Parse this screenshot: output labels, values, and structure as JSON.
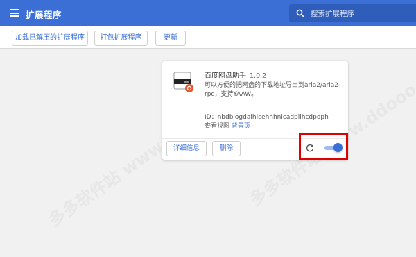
{
  "header": {
    "title": "扩展程序",
    "search_placeholder": "搜索扩展程序",
    "icons": [
      "menu-icon",
      "search-icon"
    ]
  },
  "toolbar": {
    "load_unpacked": "加载已解压的扩展程序",
    "pack": "打包扩展程序",
    "update": "更新"
  },
  "extension": {
    "name": "百度网盘助手",
    "version": "1.0.2",
    "description": "可以方便的把网盘的下载地址导出到aria2/aria2-rpc，支持YAAW。",
    "id_text": "ID：nbdbiogdaihicehhhnlcadpllhcdpoph",
    "views_prefix": "查看视图",
    "views_link": "背景页",
    "details_button": "详细信息",
    "remove_button": "删除",
    "enabled": true
  },
  "watermark": "多多软件站 www.ddooo.com",
  "colors": {
    "header": "#3b6fd6",
    "accent": "#3b6fd6",
    "highlight": "#e00000"
  }
}
